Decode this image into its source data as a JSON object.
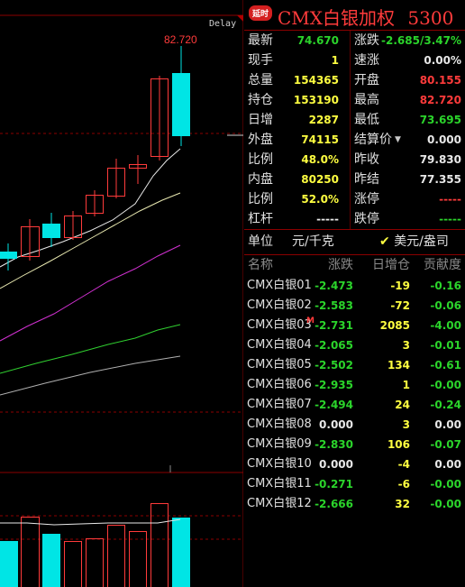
{
  "chart": {
    "delay_label": "Delay",
    "high_label": "82.720"
  },
  "header": {
    "badge": "延时",
    "title": "CMX白银加权",
    "code": "5300"
  },
  "quote_rows": [
    {
      "l1": "最新",
      "v1": "74.670",
      "c1": "#2bd42b",
      "l2": "涨跌",
      "v2": "-2.685/3.47%",
      "c2": "#2bd42b"
    },
    {
      "l1": "现手",
      "v1": "1",
      "c1": "#ffff40",
      "l2": "速涨",
      "v2": "0.00%",
      "c2": "#e8e8e8"
    },
    {
      "l1": "总量",
      "v1": "154365",
      "c1": "#ffff40",
      "l2": "开盘",
      "v2": "80.155",
      "c2": "#ff3b3b"
    },
    {
      "l1": "持仓",
      "v1": "153190",
      "c1": "#ffff40",
      "l2": "最高",
      "v2": "82.720",
      "c2": "#ff3b3b"
    },
    {
      "l1": "日增",
      "v1": "2287",
      "c1": "#ffff40",
      "l2": "最低",
      "v2": "73.695",
      "c2": "#2bd42b"
    },
    {
      "l1": "外盘",
      "v1": "74115",
      "c1": "#ffff40",
      "l2": "结算价",
      "v2": "0.000",
      "c2": "#e8e8e8"
    },
    {
      "l1": "比例",
      "v1": "48.0%",
      "c1": "#ffff40",
      "l2": "昨收",
      "v2": "79.830",
      "c2": "#e8e8e8"
    },
    {
      "l1": "内盘",
      "v1": "80250",
      "c1": "#ffff40",
      "l2": "昨结",
      "v2": "77.355",
      "c2": "#e8e8e8"
    },
    {
      "l1": "比例",
      "v1": "52.0%",
      "c1": "#ffff40",
      "l2": "涨停",
      "v2": "-----",
      "c2": "#ff3b3b"
    },
    {
      "l1": "杠杆",
      "v1": "-----",
      "c1": "#e8e8e8",
      "l2": "跌停",
      "v2": "-----",
      "c2": "#2bd42b"
    }
  ],
  "unit": {
    "label": "单位",
    "option1": "元/千克",
    "option2": "美元/盎司"
  },
  "list": {
    "headers": [
      "名称",
      "涨跌",
      "日增仓",
      "贡献度"
    ],
    "rows": [
      {
        "name": "CMX白银01",
        "chg": "-2.473",
        "oi": "-19",
        "contrib": "-0.16",
        "cc": "#2bd42b",
        "tc": "#2bd42b"
      },
      {
        "name": "CMX白银02",
        "chg": "-2.583",
        "oi": "-72",
        "contrib": "-0.06",
        "cc": "#2bd42b",
        "tc": "#2bd42b"
      },
      {
        "name": "CMX白银03",
        "chg": "-2.731",
        "oi": "2085",
        "contrib": "-4.00",
        "cc": "#2bd42b",
        "tc": "#2bd42b",
        "marker": "M"
      },
      {
        "name": "CMX白银04",
        "chg": "-2.065",
        "oi": "3",
        "contrib": "-0.01",
        "cc": "#2bd42b",
        "tc": "#2bd42b"
      },
      {
        "name": "CMX白银05",
        "chg": "-2.502",
        "oi": "134",
        "contrib": "-0.61",
        "cc": "#2bd42b",
        "tc": "#2bd42b"
      },
      {
        "name": "CMX白银06",
        "chg": "-2.935",
        "oi": "1",
        "contrib": "-0.00",
        "cc": "#2bd42b",
        "tc": "#2bd42b"
      },
      {
        "name": "CMX白银07",
        "chg": "-2.494",
        "oi": "24",
        "contrib": "-0.24",
        "cc": "#2bd42b",
        "tc": "#2bd42b"
      },
      {
        "name": "CMX白银08",
        "chg": "0.000",
        "oi": "3",
        "contrib": "0.00",
        "cc": "#e8e8e8",
        "tc": "#e8e8e8"
      },
      {
        "name": "CMX白银09",
        "chg": "-2.830",
        "oi": "106",
        "contrib": "-0.07",
        "cc": "#2bd42b",
        "tc": "#2bd42b"
      },
      {
        "name": "CMX白银10",
        "chg": "0.000",
        "oi": "-4",
        "contrib": "0.00",
        "cc": "#e8e8e8",
        "tc": "#e8e8e8"
      },
      {
        "name": "CMX白银11",
        "chg": "-0.271",
        "oi": "-6",
        "contrib": "-0.00",
        "cc": "#2bd42b",
        "tc": "#2bd42b"
      },
      {
        "name": "CMX白银12",
        "chg": "-2.666",
        "oi": "32",
        "contrib": "-0.00",
        "cc": "#2bd42b",
        "tc": "#2bd42b"
      }
    ]
  },
  "colors": {
    "background": "#000000",
    "up": "#ff3b3b",
    "down": "#2bd42b",
    "volume_down": "#00e5e5",
    "frame": "#8b0000"
  }
}
